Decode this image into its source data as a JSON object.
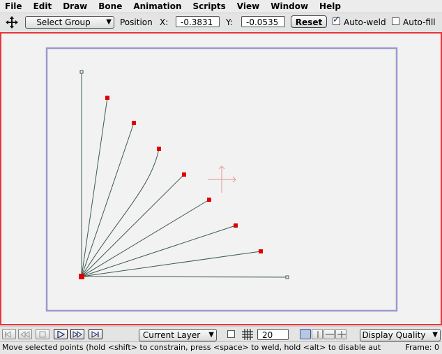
{
  "menu": [
    "File",
    "Edit",
    "Draw",
    "Bone",
    "Animation",
    "Scripts",
    "View",
    "Window",
    "Help"
  ],
  "toolbar": {
    "tool_icon": "move-arrows-icon",
    "select_group": "Select Group",
    "position_label": "Position",
    "x_label": "X:",
    "x_value": "-0.3831",
    "y_label": "Y:",
    "y_value": "-0.0535",
    "reset_label": "Reset",
    "auto_weld_label": "Auto-weld",
    "auto_weld_checked": true,
    "auto_fill_label": "Auto-fill",
    "auto_fill_checked": false
  },
  "canvas": {
    "frame_border_color": "#9b99cc",
    "line_color": "#3d5a52",
    "selected_point_color": "#e00000",
    "origin_crosshair_color": "#e3a5a5",
    "canvas_border_color": "#e8353a"
  },
  "playback": {
    "buttons": [
      "rewind-to-start-icon",
      "step-back-icon",
      "stop-icon",
      "play-icon",
      "fast-forward-icon",
      "skip-to-end-icon"
    ],
    "layer_select": "Current Layer",
    "grid_checked": false,
    "grid_icon": "grid-icon",
    "grid_size": "20",
    "view_buttons": [
      "single-view-icon",
      "split-vertical-icon",
      "split-horizontal-icon",
      "quad-view-icon"
    ],
    "quality_select": "Display Quality"
  },
  "status": {
    "message": "Move selected points (hold <shift> to constrain, press <space> to weld, hold <alt> to disable aut",
    "frame": "Frame: 0"
  }
}
